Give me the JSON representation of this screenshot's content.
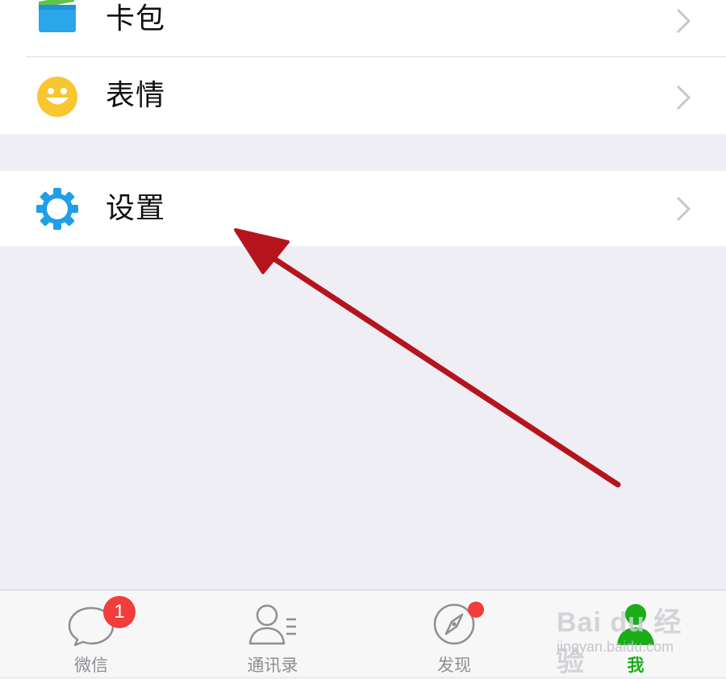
{
  "menu": {
    "items": [
      {
        "label": "卡包",
        "icon": "card-wallet-icon"
      },
      {
        "label": "表情",
        "icon": "smiley-face-icon"
      },
      {
        "label": "设置",
        "icon": "gear-icon"
      }
    ]
  },
  "tabbar": {
    "tabs": [
      {
        "label": "微信",
        "icon": "chat-bubble-icon",
        "badge": "1",
        "active": false
      },
      {
        "label": "通讯录",
        "icon": "contacts-icon",
        "active": false
      },
      {
        "label": "发现",
        "icon": "compass-icon",
        "dot": true,
        "active": false
      },
      {
        "label": "我",
        "icon": "person-icon",
        "active": true
      }
    ]
  },
  "watermark": {
    "main": "Bai du 经验",
    "sub": "jingyan.baidu.com"
  },
  "colors": {
    "background": "#efeef4",
    "active_green": "#1aad19",
    "inactive_gray": "#8e8e93",
    "badge_red": "#f23d3a",
    "annotation_arrow": "#b5141c",
    "gear_blue": "#1e9fe6",
    "smiley_yellow": "#f8c62f"
  }
}
